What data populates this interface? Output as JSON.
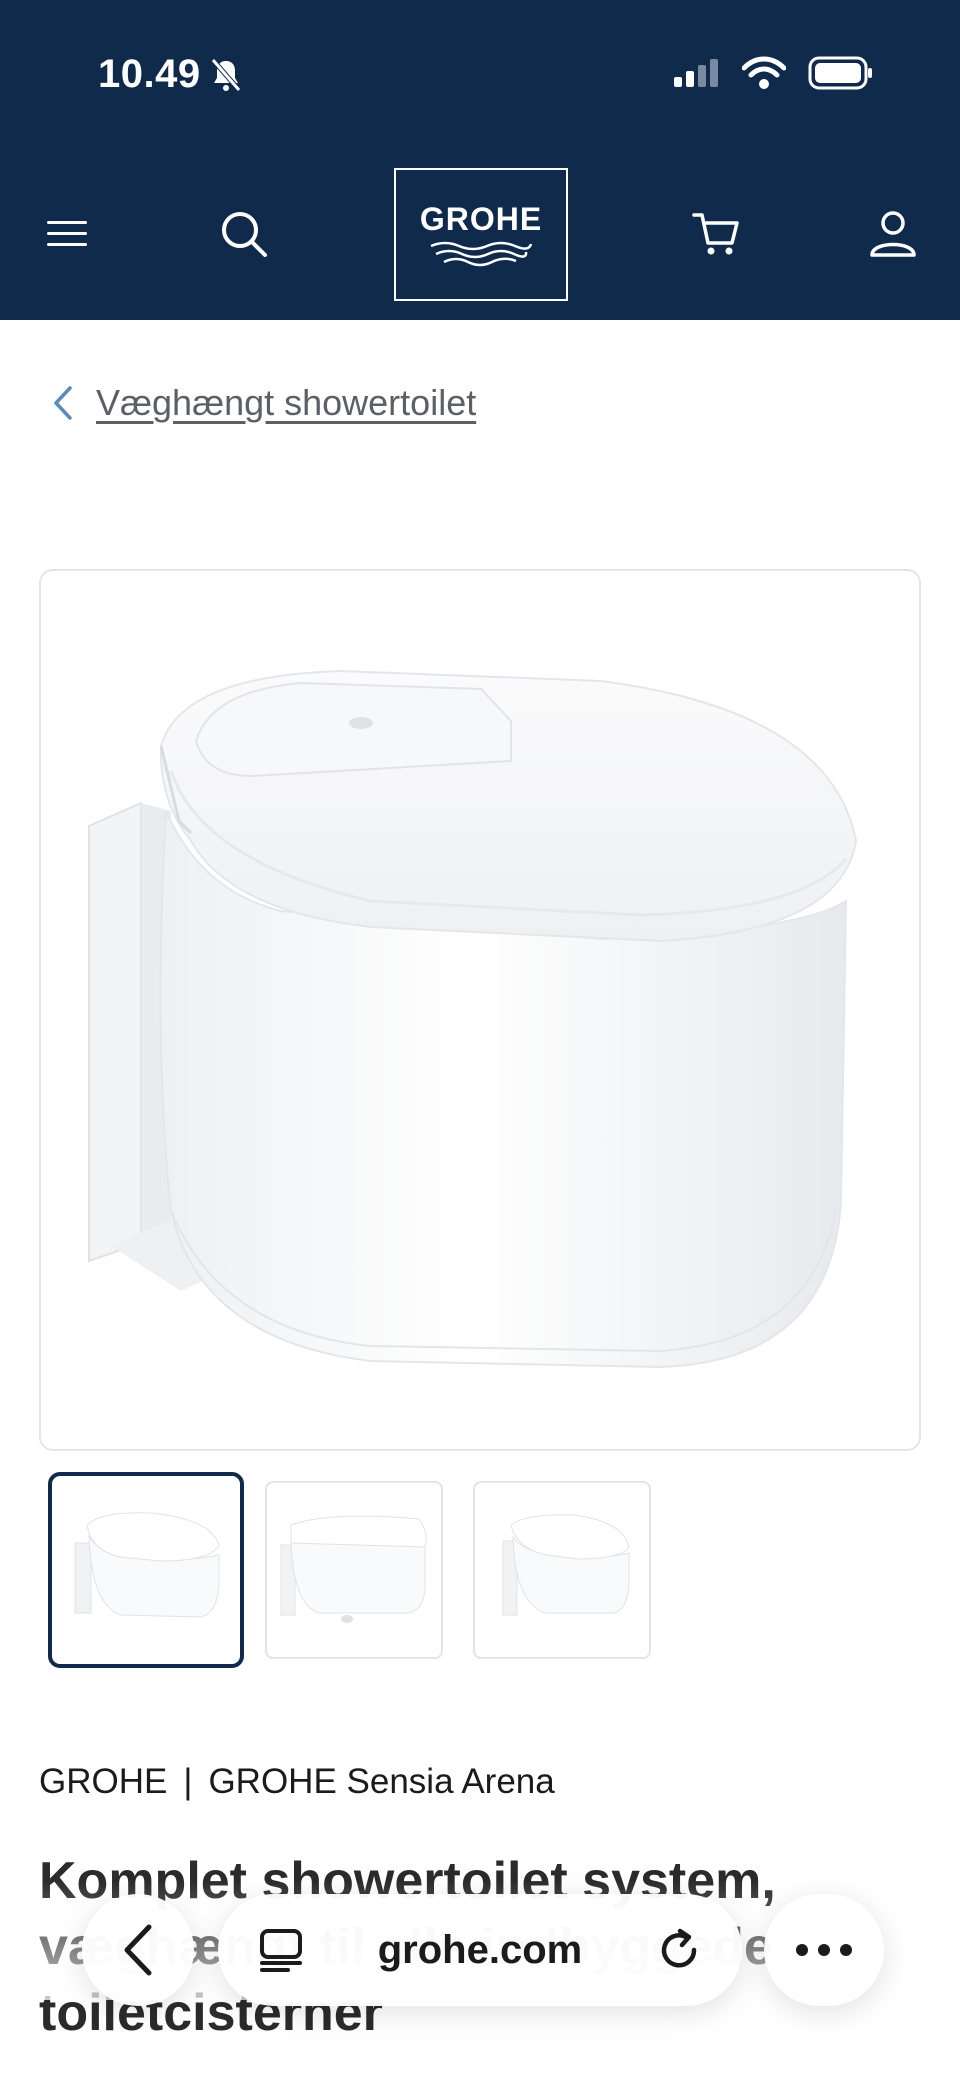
{
  "status": {
    "time": "10.49"
  },
  "header": {
    "logo_text": "GROHE",
    "icons": [
      "menu-icon",
      "search-icon",
      "cart-icon",
      "user-icon"
    ]
  },
  "breadcrumb": {
    "label": "Væghængt showertoilet"
  },
  "product": {
    "brand": "GROHE",
    "separator": "|",
    "collection": "GROHE Sensia Arena",
    "title": "Komplet showertoilet system, væghængt til alle indbyggede toiletcisterner"
  },
  "gallery": {
    "thumb_count": 3,
    "active_index": 0
  },
  "browser": {
    "url": "grohe.com"
  },
  "colors": {
    "header_bg": "#102a4c",
    "accent": "#5a8ab8"
  }
}
